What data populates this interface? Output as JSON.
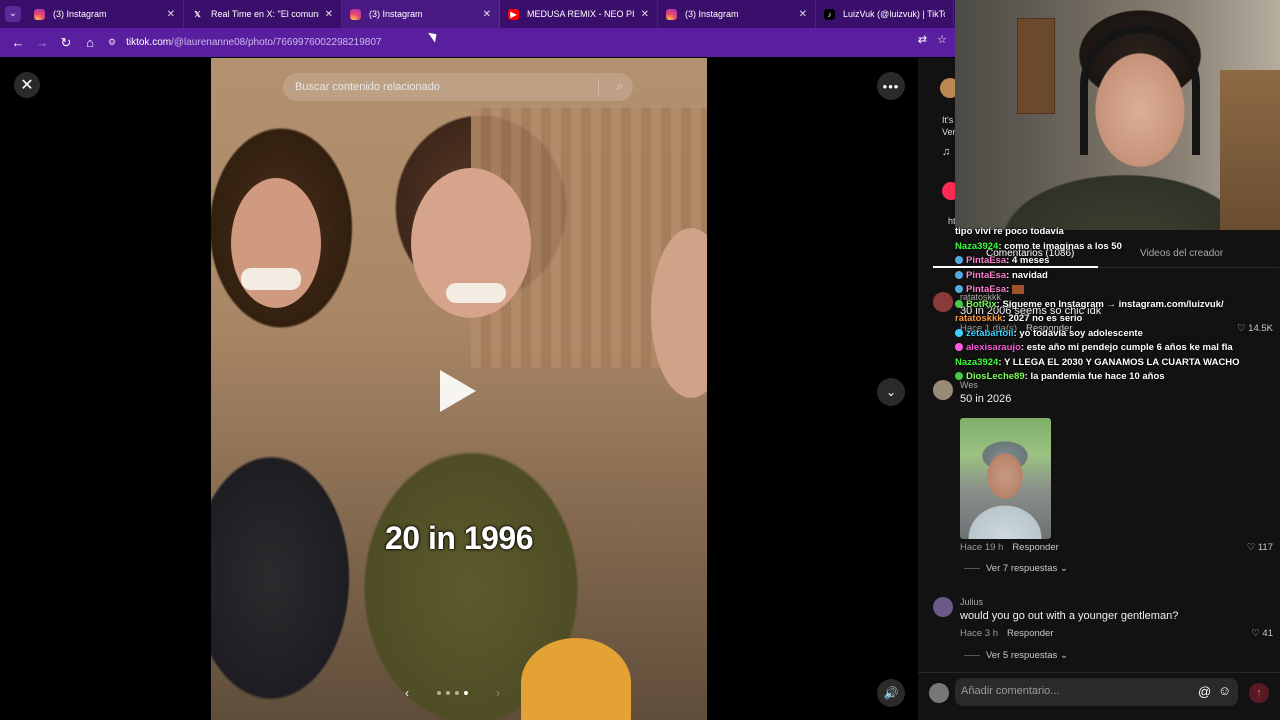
{
  "browser": {
    "tabs": [
      {
        "title": "(3) Instagram",
        "icon": "instagram-icon",
        "active": false
      },
      {
        "title": "Real Time en X: \"El comunicado",
        "icon": "x-icon",
        "active": false
      },
      {
        "title": "(3) Instagram",
        "icon": "instagram-icon",
        "active": true
      },
      {
        "title": "MEDUSA REMIX - NEO PISTEA",
        "icon": "youtube-icon",
        "active": false
      },
      {
        "title": "(3) Instagram",
        "icon": "instagram-icon",
        "active": false
      },
      {
        "title": "LuizVuk (@luizvuk) | TikTok",
        "icon": "tiktok-icon",
        "active": false
      }
    ],
    "url_host": "tiktok.com",
    "url_path": "/@laurenanne08/photo/7669976002298219807",
    "tabbar_color": "#3a0f6b",
    "urlbar_color": "#5a1f9e"
  },
  "viewer": {
    "search_placeholder": "Buscar contenido relacionado",
    "overlay_text": "20 in 1996",
    "carousel_total": 4,
    "carousel_active": 4
  },
  "panel": {
    "author_snippets": [
      "It's",
      "Ver",
      "ht"
    ],
    "tabs": {
      "comments": "Comentarios (1086)",
      "creator_videos": "Videos del creador"
    },
    "comments": [
      {
        "user": "ratatoskkk",
        "text": "30 in 2006 seems so chic idk",
        "time": "Hace 1 día(s)",
        "reply_label": "Responder",
        "likes": "14.5K"
      },
      {
        "user": "Wes",
        "text": "50 in 2026",
        "time": "Hace 19 h",
        "reply_label": "Responder",
        "likes": "117",
        "view_replies": "Ver 7 respuestas"
      },
      {
        "user": "Julius",
        "text": "would you go out with a younger gentleman?",
        "time": "Hace 3 h",
        "reply_label": "Responder",
        "likes": "41",
        "view_replies": "Ver 5 respuestas"
      }
    ],
    "composer_placeholder": "Añadir comentario...",
    "like_color": "#fe2c55"
  },
  "chat": {
    "messages": [
      {
        "user": "",
        "text": "tipo viví re poco todavía",
        "color": "#ffffff"
      },
      {
        "user": "Naza3924",
        "text": "como te imaginas a los 50",
        "color": "#3cff3c"
      },
      {
        "user": "PintaEsa",
        "text": "4 meses",
        "color": "#ff7fd1"
      },
      {
        "user": "PintaEsa",
        "text": "navidad",
        "color": "#ff7fd1"
      },
      {
        "user": "PintaEsa",
        "text": "",
        "color": "#ff7fd1"
      },
      {
        "user": "BotRix",
        "text": "Sigueme en Instagram → instagram.com/luizvuk/",
        "color": "#7cff5a"
      },
      {
        "user": "ratatoskkk",
        "text": "2027 no es serio",
        "color": "#ff9a3c"
      },
      {
        "user": "zetabartoli",
        "text": "yo todavía soy adolescente",
        "color": "#3cd0ff"
      },
      {
        "user": "alexisaraujo",
        "text": "este año mi pendejo cumple 6 años ke mal fla",
        "color": "#ff5adc"
      },
      {
        "user": "Naza3924",
        "text": "Y LLEGA EL 2030 Y GANAMOS LA CUARTA WACHO",
        "color": "#3cff3c"
      },
      {
        "user": "DiosLeche89",
        "text": "la pandemia fue hace 10 años",
        "color": "#7cff5a"
      }
    ]
  }
}
